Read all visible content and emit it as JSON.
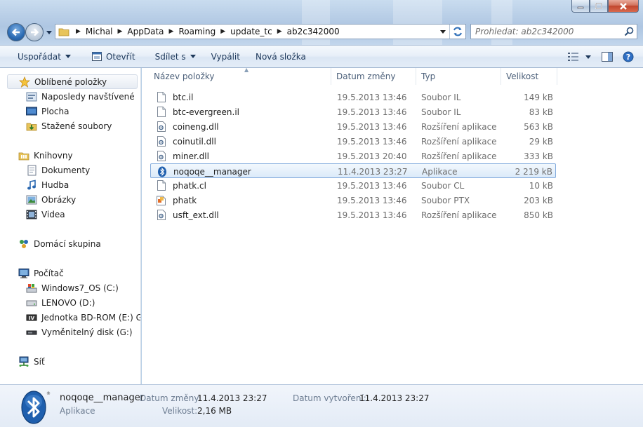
{
  "window": {
    "colors": {
      "accent": "#2b6bb3",
      "selection_border": "#84acdd",
      "close_button": "#c0452d"
    }
  },
  "address": {
    "breadcrumb": [
      "Michal",
      "AppData",
      "Roaming",
      "update_tc",
      "ab2c342000"
    ]
  },
  "search": {
    "placeholder": "Prohledat: ab2c342000"
  },
  "toolbar": {
    "organize_label": "Uspořádat",
    "open_label": "Otevřít",
    "share_label": "Sdílet s",
    "burn_label": "Vypálit",
    "new_folder_label": "Nová složka"
  },
  "sidebar": {
    "favorites": {
      "label": "Oblíbené položky",
      "items": [
        "Naposledy navštívené",
        "Plocha",
        "Stažené soubory"
      ]
    },
    "libraries": {
      "label": "Knihovny",
      "items": [
        "Dokumenty",
        "Hudba",
        "Obrázky",
        "Videa"
      ]
    },
    "homegroup": {
      "label": "Domácí skupina"
    },
    "computer": {
      "label": "Počítač",
      "items": [
        "Windows7_OS (C:)",
        "LENOVO (D:)",
        "Jednotka BD-ROM (E:) GTA",
        "Vyměnitelný disk (G:)"
      ]
    },
    "network": {
      "label": "Síť"
    }
  },
  "columns": {
    "name": "Název položky",
    "date": "Datum změny",
    "type": "Typ",
    "size": "Velikost"
  },
  "files": [
    {
      "name": "btc.il",
      "date": "19.5.2013 13:46",
      "type": "Soubor IL",
      "size": "149 kB",
      "icon": "file-icon"
    },
    {
      "name": "btc-evergreen.il",
      "date": "19.5.2013 13:46",
      "type": "Soubor IL",
      "size": "83 kB",
      "icon": "file-icon"
    },
    {
      "name": "coineng.dll",
      "date": "19.5.2013 13:46",
      "type": "Rozšíření aplikace",
      "size": "563 kB",
      "icon": "dll-icon"
    },
    {
      "name": "coinutil.dll",
      "date": "19.5.2013 13:46",
      "type": "Rozšíření aplikace",
      "size": "29 kB",
      "icon": "dll-icon"
    },
    {
      "name": "miner.dll",
      "date": "19.5.2013 20:40",
      "type": "Rozšíření aplikace",
      "size": "333 kB",
      "icon": "dll-icon"
    },
    {
      "name": "noqoqe__manager",
      "date": "11.4.2013 23:27",
      "type": "Aplikace",
      "size": "2 219 kB",
      "icon": "bluetooth-icon",
      "selected": true
    },
    {
      "name": "phatk.cl",
      "date": "19.5.2013 13:46",
      "type": "Soubor CL",
      "size": "10 kB",
      "icon": "file-icon"
    },
    {
      "name": "phatk",
      "date": "19.5.2013 13:46",
      "type": "Soubor PTX",
      "size": "203 kB",
      "icon": "ptx-icon"
    },
    {
      "name": "usft_ext.dll",
      "date": "19.5.2013 13:46",
      "type": "Rozšíření aplikace",
      "size": "850 kB",
      "icon": "dll-icon"
    }
  ],
  "details": {
    "name": "noqoqe__manager",
    "type": "Aplikace",
    "modified_label": "Datum změny:",
    "modified_value": "11.4.2013 23:27",
    "created_label": "Datum vytvoření:",
    "created_value": "11.4.2013 23:27",
    "size_label": "Velikost:",
    "size_value": "2,16 MB"
  }
}
